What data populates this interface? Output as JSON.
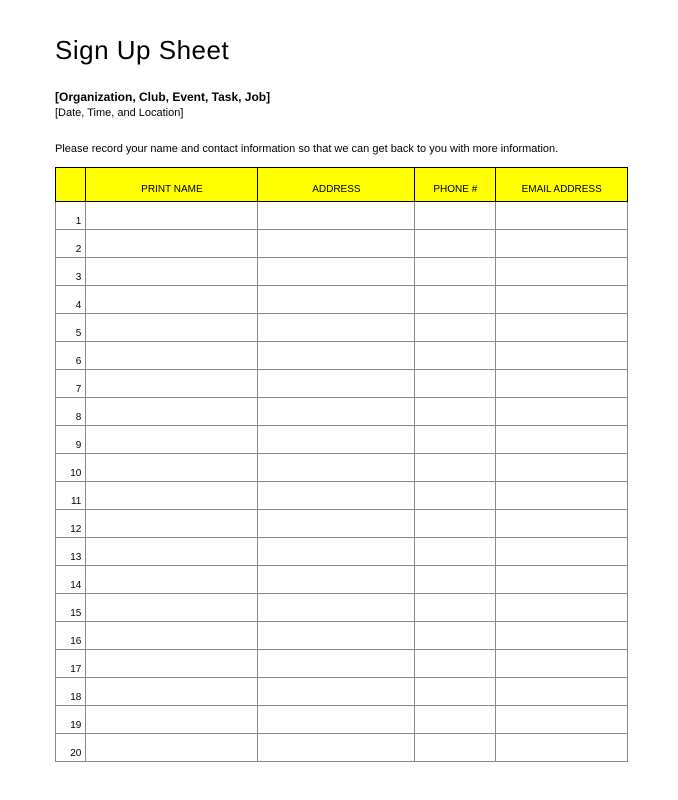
{
  "title": "Sign Up Sheet",
  "subtitle": "[Organization, Club, Event, Task, Job]",
  "datetime": "[Date, Time, and Location]",
  "instructions": "Please record your name and contact information so that we can get back to you with more information.",
  "headers": {
    "num": "",
    "name": "PRINT NAME",
    "address": "ADDRESS",
    "phone": "PHONE #",
    "email": "EMAIL ADDRESS"
  },
  "rows": [
    {
      "n": "1"
    },
    {
      "n": "2"
    },
    {
      "n": "3"
    },
    {
      "n": "4"
    },
    {
      "n": "5"
    },
    {
      "n": "6"
    },
    {
      "n": "7"
    },
    {
      "n": "8"
    },
    {
      "n": "9"
    },
    {
      "n": "10"
    },
    {
      "n": "11"
    },
    {
      "n": "12"
    },
    {
      "n": "13"
    },
    {
      "n": "14"
    },
    {
      "n": "15"
    },
    {
      "n": "16"
    },
    {
      "n": "17"
    },
    {
      "n": "18"
    },
    {
      "n": "19"
    },
    {
      "n": "20"
    }
  ]
}
